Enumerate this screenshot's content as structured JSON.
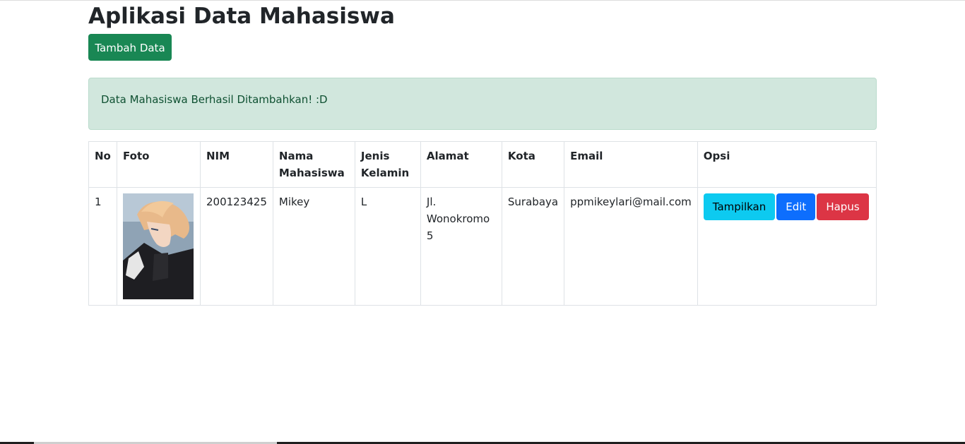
{
  "page": {
    "title": "Aplikasi Data Mahasiswa",
    "add_button": "Tambah Data"
  },
  "alert": {
    "message": "Data Mahasiswa Berhasil Ditambahkan! :D",
    "color": "#d1e7dd"
  },
  "table": {
    "headers": {
      "no": "No",
      "foto": "Foto",
      "nim": "NIM",
      "nama_1": "Nama",
      "nama_2": "Mahasiswa",
      "jk_1": "Jenis",
      "jk_2": "Kelamin",
      "alamat": "Alamat",
      "kota": "Kota",
      "email": "Email",
      "opsi": "Opsi"
    },
    "rows": [
      {
        "no": "1",
        "nim": "200123425",
        "nama": "Mikey",
        "jenis_kelamin": "L",
        "alamat": "Jl. Wonokromo 5",
        "kota": "Surabaya",
        "email": "ppmikeylari@mail.com",
        "actions": {
          "show": "Tampilkan",
          "edit": "Edit",
          "delete": "Hapus"
        }
      }
    ]
  },
  "colors": {
    "success": "#198754",
    "info": "#0dcaf0",
    "primary": "#0d6efd",
    "danger": "#dc3545"
  }
}
